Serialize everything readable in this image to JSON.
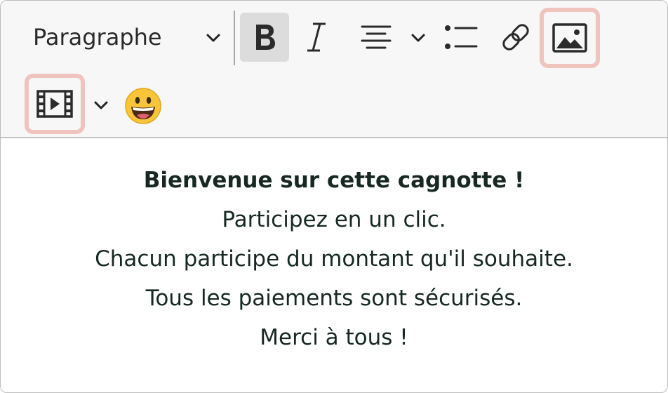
{
  "toolbar": {
    "format_label": "Paragraphe",
    "icons": {
      "format_dropdown": "chevron-down-icon",
      "bold": "bold-icon",
      "italic": "italic-icon",
      "align": "align-center-icon",
      "align_dropdown": "chevron-down-icon",
      "list": "bullet-list-icon",
      "link": "link-icon",
      "image": "image-icon",
      "video": "video-icon",
      "video_dropdown": "chevron-down-icon",
      "emoji": "smiley-emoji-icon"
    },
    "highlighted_buttons": [
      "image",
      "video"
    ]
  },
  "content": {
    "heading": "Bienvenue sur cette cagnotte !",
    "lines": [
      "Participez en un clic.",
      "Chacun participe du montant qu'il souhaite.",
      "Tous les paiements sont sécurisés.",
      "Merci à tous !"
    ]
  },
  "colors": {
    "toolbar_bg": "#f7f7f7",
    "active_button_bg": "#dcdcdc",
    "highlight_border": "#efc4bf",
    "text": "#172822"
  }
}
